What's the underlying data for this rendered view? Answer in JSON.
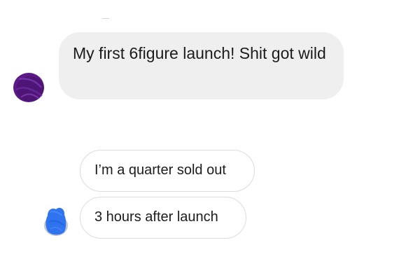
{
  "conversation": {
    "received_message": "My first 6figure launch! Shit got wild",
    "sent_messages": [
      "I’m a quarter sold out",
      "3 hours after launch"
    ]
  },
  "colors": {
    "received_bubble": "#efefef",
    "sent_bubble_border": "#dcdcdc",
    "text": "#1c1c1c",
    "received_avatar_scribble": "#5b1a86",
    "sent_avatar_scribble": "#2f74ee"
  },
  "icons": {
    "received_avatar": "redacted-avatar-icon",
    "sent_avatar": "redacted-avatar-icon"
  }
}
